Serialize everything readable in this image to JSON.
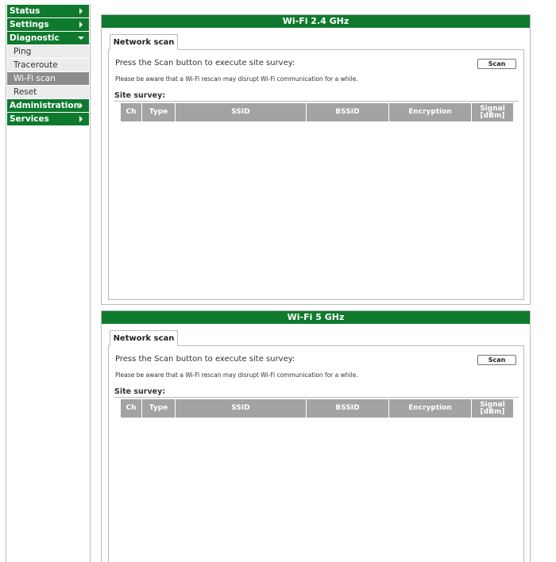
{
  "sidebar": {
    "status": "Status",
    "settings": "Settings",
    "diagnostic": "Diagnostic",
    "diagnostic_items": [
      "Ping",
      "Traceroute",
      "Wi-Fi scan",
      "Reset"
    ],
    "active_item": "Wi-Fi scan",
    "administration": "Administration",
    "services": "Services"
  },
  "panels": [
    {
      "title": "Wi-Fi 2.4 GHz",
      "tab": "Network scan",
      "press_text": "Press the Scan button to execute site survey:",
      "scan_label": "Scan",
      "warning": "Please be aware that a Wi-Fi rescan may disrupt Wi-Fi communication for a while.",
      "survey_label": "Site survey:",
      "columns": [
        "Ch",
        "Type",
        "SSID",
        "BSSID",
        "Encryption",
        "Signal",
        "[dBm]"
      ]
    },
    {
      "title": "Wi-Fi 5 GHz",
      "tab": "Network scan",
      "press_text": "Press the Scan button to execute site survey:",
      "scan_label": "Scan",
      "warning": "Please be aware that a Wi-Fi rescan may disrupt Wi-Fi communication for a while.",
      "survey_label": "Site survey:",
      "columns": [
        "Ch",
        "Type",
        "SSID",
        "BSSID",
        "Encryption",
        "Signal",
        "[dBm]"
      ]
    }
  ],
  "colors": {
    "brand_green": "#0f7a2e",
    "header_gray": "#a3a3a3",
    "active_gray": "#8c8c8c"
  }
}
